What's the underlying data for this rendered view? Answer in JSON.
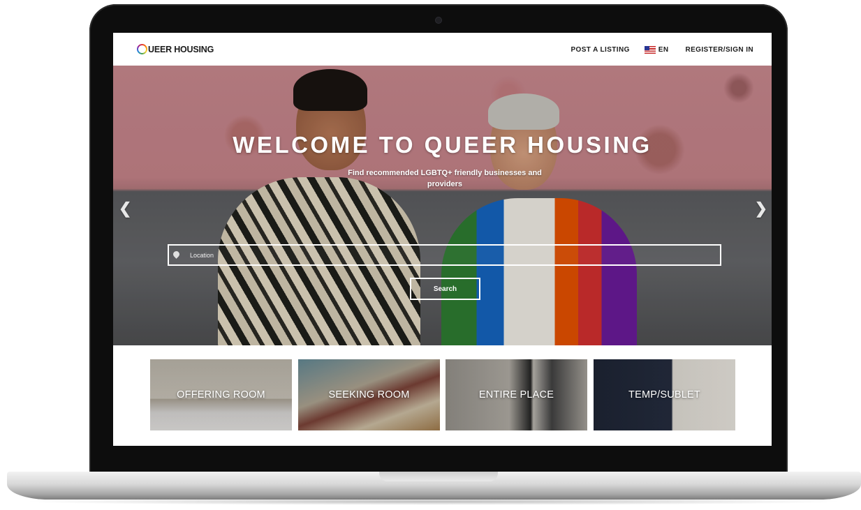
{
  "brand": {
    "logo_text": "UEER HOUSING",
    "logo_q": "Q"
  },
  "nav": {
    "post_listing": "POST A LISTING",
    "language": "EN",
    "register": "REGISTER/SIGN IN"
  },
  "hero": {
    "title": "WELCOME TO QUEER HOUSING",
    "subtitle": "Find recommended LGBTQ+ friendly businesses and providers",
    "location_placeholder": "Location",
    "search_label": "Search",
    "arrow_prev": "❮",
    "arrow_next": "❯"
  },
  "categories": [
    {
      "label": "OFFERING ROOM"
    },
    {
      "label": "SEEKING ROOM"
    },
    {
      "label": "ENTIRE PLACE"
    },
    {
      "label": "TEMP/SUBLET"
    }
  ],
  "colors": {
    "hero_wall": "#c9898f",
    "text_dark": "#1b1b1b",
    "laptop_bezel": "#0d0d0d"
  },
  "icons": [
    "location-pin-icon",
    "us-flag-icon",
    "chevron-left-icon",
    "chevron-right-icon"
  ]
}
